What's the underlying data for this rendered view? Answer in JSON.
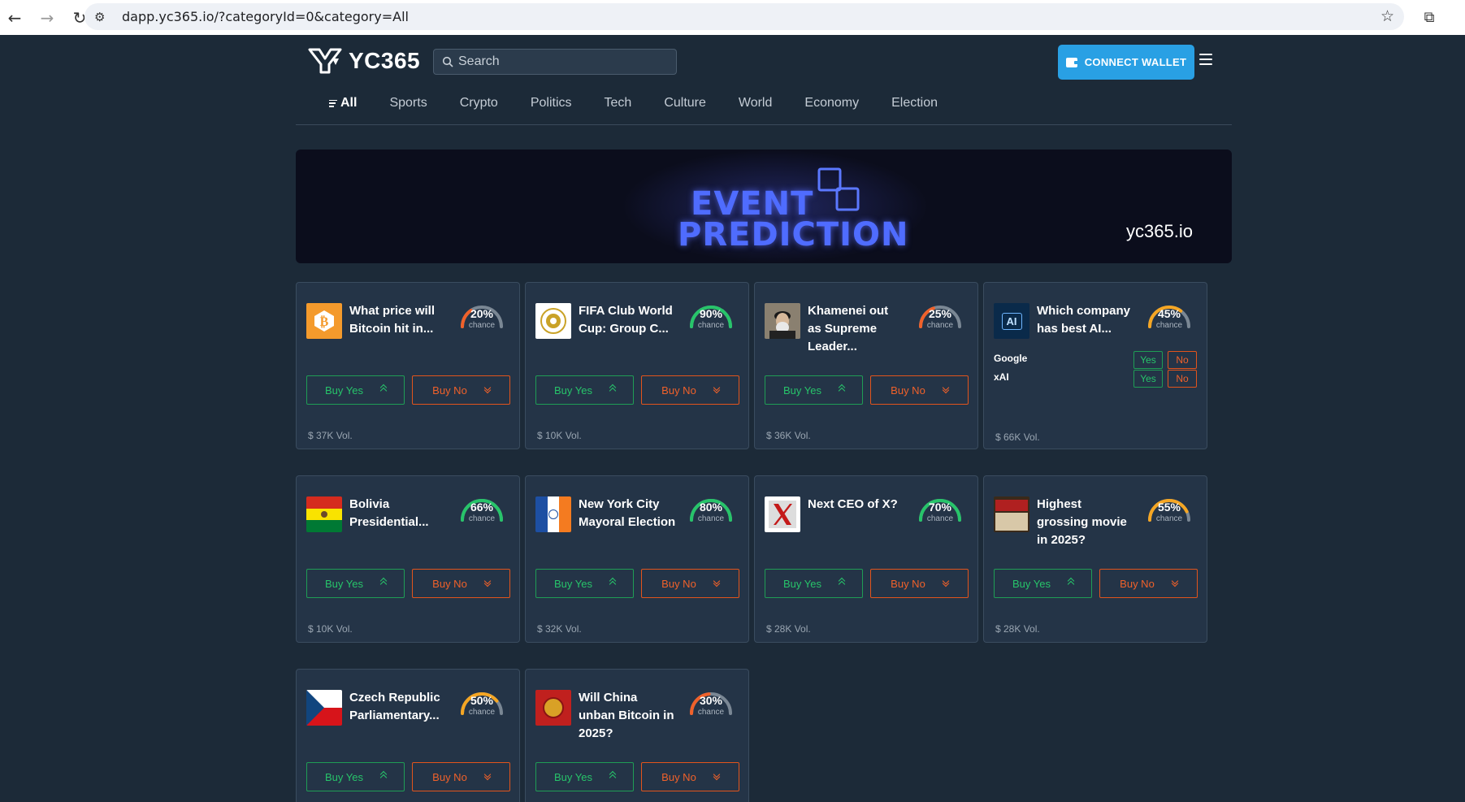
{
  "browser": {
    "url": "dapp.yc365.io/?categoryId=0&category=All",
    "icons": [
      "back-icon",
      "forward-icon",
      "reload-icon",
      "site-settings-icon",
      "bookmark-star-icon",
      "extensions-icon"
    ]
  },
  "header": {
    "brand": "YC365",
    "search_placeholder": "Search",
    "connect_label": "CONNECT WALLET"
  },
  "categories": [
    "All",
    "Sports",
    "Crypto",
    "Politics",
    "Tech",
    "Culture",
    "World",
    "Economy",
    "Election"
  ],
  "banner": {
    "line1": "EVENT",
    "line2": "PREDICTION",
    "site": "yc365.io"
  },
  "card_labels": {
    "chance": "chance",
    "buy_yes": "Buy Yes",
    "buy_no": "Buy No",
    "yes": "Yes",
    "no": "No"
  },
  "colors": {
    "background": "#1c2a38",
    "card": "#243447",
    "accent_blue": "#29a0e4",
    "yes_green": "#27c46a",
    "no_orange": "#f0612a"
  },
  "markets": [
    {
      "title": "What price will Bitcoin hit in...",
      "chance": "20%",
      "chance_value": 20,
      "gauge_color": "#f0612a",
      "volume": "$ 37K Vol.",
      "thumb": "bitcoin"
    },
    {
      "title": "FIFA Club World Cup: Group C...",
      "chance": "90%",
      "chance_value": 90,
      "gauge_color": "#27c46a",
      "volume": "$ 10K Vol.",
      "thumb": "fifa"
    },
    {
      "title": "Khamenei out as Supreme Leader...",
      "chance": "25%",
      "chance_value": 25,
      "gauge_color": "#f0612a",
      "volume": "$ 36K Vol.",
      "thumb": "portrait"
    },
    {
      "title": "Which company has best AI...",
      "chance": "45%",
      "chance_value": 45,
      "gauge_color": "#f5a623",
      "volume": "$ 66K Vol.",
      "thumb": "ai",
      "options": [
        "Google",
        "xAI"
      ]
    },
    {
      "title": "Bolivia Presidential...",
      "chance": "66%",
      "chance_value": 66,
      "gauge_color": "#27c46a",
      "volume": "$ 10K Vol.",
      "thumb": "bolivia"
    },
    {
      "title": "New York City Mayoral Election",
      "chance": "80%",
      "chance_value": 80,
      "gauge_color": "#27c46a",
      "volume": "$ 32K Vol.",
      "thumb": "nyc"
    },
    {
      "title": "Next CEO of X?",
      "chance": "70%",
      "chance_value": 70,
      "gauge_color": "#27c46a",
      "volume": "$ 28K Vol.",
      "thumb": "x"
    },
    {
      "title": "Highest grossing movie in 2025?",
      "chance": "55%",
      "chance_value": 55,
      "gauge_color": "#f5a623",
      "volume": "$ 28K Vol.",
      "thumb": "movie"
    },
    {
      "title": "Czech Republic Parliamentary...",
      "chance": "50%",
      "chance_value": 50,
      "gauge_color": "#f5a623",
      "volume": "",
      "thumb": "czech"
    },
    {
      "title": "Will China unban Bitcoin in 2025?",
      "chance": "30%",
      "chance_value": 30,
      "gauge_color": "#f0612a",
      "volume": "",
      "thumb": "china"
    }
  ]
}
